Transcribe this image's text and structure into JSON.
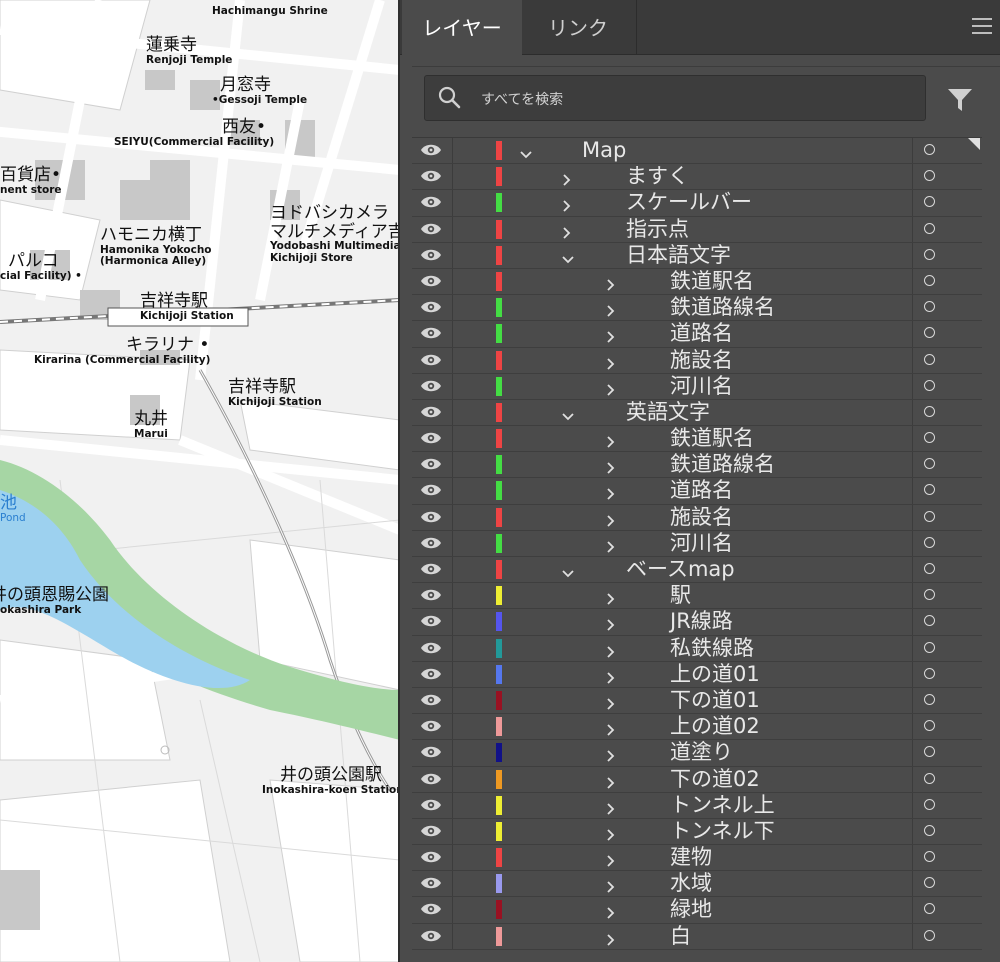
{
  "map": {
    "labels": {
      "hachimangu": "Hachimangu Shrine",
      "renjoji_ja": "蓮乗寺",
      "renjoji_en": "Renjoji Temple",
      "gessoji_ja": "月窓寺",
      "gessoji_en": "•Gessoji Temple",
      "seiyu_ja": "西友•",
      "seiyu_en": "SEIYU(Commercial Facility)",
      "dept_ja": "百貨店•",
      "dept_en": "nent store",
      "harmonica_ja": "ハモニカ横丁",
      "harmonica_en1": "Hamonika Yokocho",
      "harmonica_en2": "(Harmonica Alley)",
      "yodobashi_ja1": "ヨドバシカメラ",
      "yodobashi_ja2": "マルチメディア吉",
      "yodobashi_en1": "Yodobashi Multimedia",
      "yodobashi_en2": "Kichijoji Store",
      "parco_ja": "パルコ",
      "parco_en": "cial Facility) •",
      "kichijoji_ja": "吉祥寺駅",
      "kichijoji_en": "Kichijoji Station",
      "kirarina_ja": "キラリナ •",
      "kirarina_en": "Kirarina (Commercial Facility)",
      "kichijoji2_ja": "吉祥寺駅",
      "kichijoji2_en": "Kichijoji Station",
      "marui_ja": "丸井",
      "marui_en": "Marui",
      "pond_ja": "池",
      "pond_en": "Pond",
      "park_ja": "井の頭恩賜公園",
      "park_en": "okashira Park",
      "inokashira_ja": "井の頭公園駅",
      "inokashira_en": "Inokashira-koen Station"
    }
  },
  "panel": {
    "tabs": {
      "layers": "レイヤー",
      "links": "リンク"
    },
    "search": {
      "placeholder": "すべてを検索"
    },
    "layers": [
      {
        "name": "Map",
        "color": "#ee4444",
        "depth": 0,
        "expanded": true
      },
      {
        "name": "ますく",
        "color": "#ee4444",
        "depth": 1,
        "expanded": false
      },
      {
        "name": "スケールバー",
        "color": "#44dd44",
        "depth": 1,
        "expanded": false
      },
      {
        "name": "指示点",
        "color": "#ee4444",
        "depth": 1,
        "expanded": false
      },
      {
        "name": "日本語文字",
        "color": "#ee4444",
        "depth": 1,
        "expanded": true
      },
      {
        "name": "鉄道駅名",
        "color": "#ee4444",
        "depth": 2,
        "expanded": false
      },
      {
        "name": "鉄道路線名",
        "color": "#44dd44",
        "depth": 2,
        "expanded": false
      },
      {
        "name": "道路名",
        "color": "#44dd44",
        "depth": 2,
        "expanded": false
      },
      {
        "name": "施設名",
        "color": "#ee4444",
        "depth": 2,
        "expanded": false
      },
      {
        "name": "河川名",
        "color": "#44dd44",
        "depth": 2,
        "expanded": false
      },
      {
        "name": "英語文字",
        "color": "#ee4444",
        "depth": 1,
        "expanded": true
      },
      {
        "name": "鉄道駅名",
        "color": "#ee4444",
        "depth": 2,
        "expanded": false
      },
      {
        "name": "鉄道路線名",
        "color": "#44dd44",
        "depth": 2,
        "expanded": false
      },
      {
        "name": "道路名",
        "color": "#44dd44",
        "depth": 2,
        "expanded": false
      },
      {
        "name": "施設名",
        "color": "#ee4444",
        "depth": 2,
        "expanded": false
      },
      {
        "name": "河川名",
        "color": "#44dd44",
        "depth": 2,
        "expanded": false
      },
      {
        "name": "ベースmap",
        "color": "#ee4444",
        "depth": 1,
        "expanded": true
      },
      {
        "name": "駅",
        "color": "#eeee33",
        "depth": 2,
        "expanded": false
      },
      {
        "name": "JR線路",
        "color": "#5555ee",
        "depth": 2,
        "expanded": false
      },
      {
        "name": "私鉄線路",
        "color": "#229999",
        "depth": 2,
        "expanded": false
      },
      {
        "name": "上の道01",
        "color": "#5577ee",
        "depth": 2,
        "expanded": false
      },
      {
        "name": "下の道01",
        "color": "#991122",
        "depth": 2,
        "expanded": false
      },
      {
        "name": "上の道02",
        "color": "#ee9999",
        "depth": 2,
        "expanded": false
      },
      {
        "name": "道塗り",
        "color": "#111188",
        "depth": 2,
        "expanded": false
      },
      {
        "name": "下の道02",
        "color": "#ee9922",
        "depth": 2,
        "expanded": false
      },
      {
        "name": "トンネル上",
        "color": "#eeee33",
        "depth": 2,
        "expanded": false
      },
      {
        "name": "トンネル下",
        "color": "#eeee33",
        "depth": 2,
        "expanded": false
      },
      {
        "name": "建物",
        "color": "#ee4444",
        "depth": 2,
        "expanded": false
      },
      {
        "name": "水域",
        "color": "#9999ee",
        "depth": 2,
        "expanded": false
      },
      {
        "name": "緑地",
        "color": "#991122",
        "depth": 2,
        "expanded": false
      },
      {
        "name": "白",
        "color": "#ee9999",
        "depth": 2,
        "expanded": false
      }
    ]
  }
}
